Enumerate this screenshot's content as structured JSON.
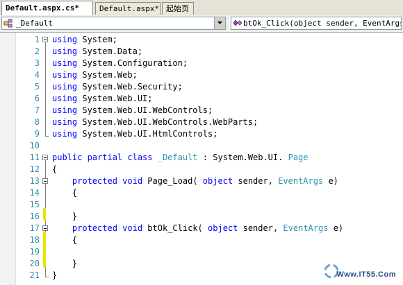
{
  "tabs": [
    {
      "label": "Default.aspx.cs*",
      "active": true
    },
    {
      "label": "Default.aspx*",
      "active": false
    },
    {
      "label": "起始页",
      "active": false
    }
  ],
  "nav": {
    "class_combo": "_Default",
    "member_combo": "btOk_Click(object sender, EventArgs e)"
  },
  "code_lines": [
    {
      "n": "1",
      "parts": [
        [
          "kw",
          "using"
        ],
        [
          "",
          "System;"
        ]
      ]
    },
    {
      "n": "2",
      "parts": [
        [
          "kw",
          "using"
        ],
        [
          "",
          "System.Data;"
        ]
      ]
    },
    {
      "n": "3",
      "parts": [
        [
          "kw",
          "using"
        ],
        [
          "",
          "System.Configuration;"
        ]
      ]
    },
    {
      "n": "4",
      "parts": [
        [
          "kw",
          "using"
        ],
        [
          "",
          "System.Web;"
        ]
      ]
    },
    {
      "n": "5",
      "parts": [
        [
          "kw",
          "using"
        ],
        [
          "",
          "System.Web.Security;"
        ]
      ]
    },
    {
      "n": "6",
      "parts": [
        [
          "kw",
          "using"
        ],
        [
          "",
          "System.Web.UI;"
        ]
      ]
    },
    {
      "n": "7",
      "parts": [
        [
          "kw",
          "using"
        ],
        [
          "",
          "System.Web.UI.WebControls;"
        ]
      ]
    },
    {
      "n": "8",
      "parts": [
        [
          "kw",
          "using"
        ],
        [
          "",
          "System.Web.UI.WebControls.WebParts;"
        ]
      ]
    },
    {
      "n": "9",
      "parts": [
        [
          "kw",
          "using"
        ],
        [
          "",
          "System.Web.UI.HtmlControls;"
        ]
      ]
    },
    {
      "n": "10",
      "parts": []
    },
    {
      "n": "11",
      "parts": [
        [
          "kw",
          "public partial class"
        ],
        [
          "ty",
          "_Default"
        ],
        [
          "",
          ": System.Web.UI."
        ],
        [
          "ty",
          "Page"
        ]
      ]
    },
    {
      "n": "12",
      "parts": [
        [
          "",
          "{"
        ]
      ]
    },
    {
      "n": "13",
      "parts": [
        [
          "",
          "    "
        ],
        [
          "kw",
          "protected void"
        ],
        [
          "",
          "Page_Load("
        ],
        [
          "kw",
          "object"
        ],
        [
          "",
          "sender,"
        ],
        [
          "ty",
          "EventArgs"
        ],
        [
          "",
          "e)"
        ]
      ]
    },
    {
      "n": "14",
      "parts": [
        [
          "",
          "    {"
        ]
      ]
    },
    {
      "n": "15",
      "parts": []
    },
    {
      "n": "16",
      "parts": [
        [
          "",
          "    }"
        ]
      ]
    },
    {
      "n": "17",
      "parts": [
        [
          "",
          "    "
        ],
        [
          "kw",
          "protected void"
        ],
        [
          "",
          "btOk_Click("
        ],
        [
          "kw",
          "object"
        ],
        [
          "",
          "sender,"
        ],
        [
          "ty",
          "EventArgs"
        ],
        [
          "",
          "e)"
        ]
      ]
    },
    {
      "n": "18",
      "parts": [
        [
          "",
          "    {"
        ]
      ]
    },
    {
      "n": "19",
      "parts": []
    },
    {
      "n": "20",
      "parts": [
        [
          "",
          "    }"
        ]
      ]
    },
    {
      "n": "21",
      "parts": [
        [
          "",
          "}"
        ]
      ]
    }
  ],
  "watermark": "Www.IT55.Com",
  "colors": {
    "keyword": "#0000ff",
    "type": "#2b91af",
    "line_number": "#2b91af",
    "changed_marker": "#e6e600"
  }
}
